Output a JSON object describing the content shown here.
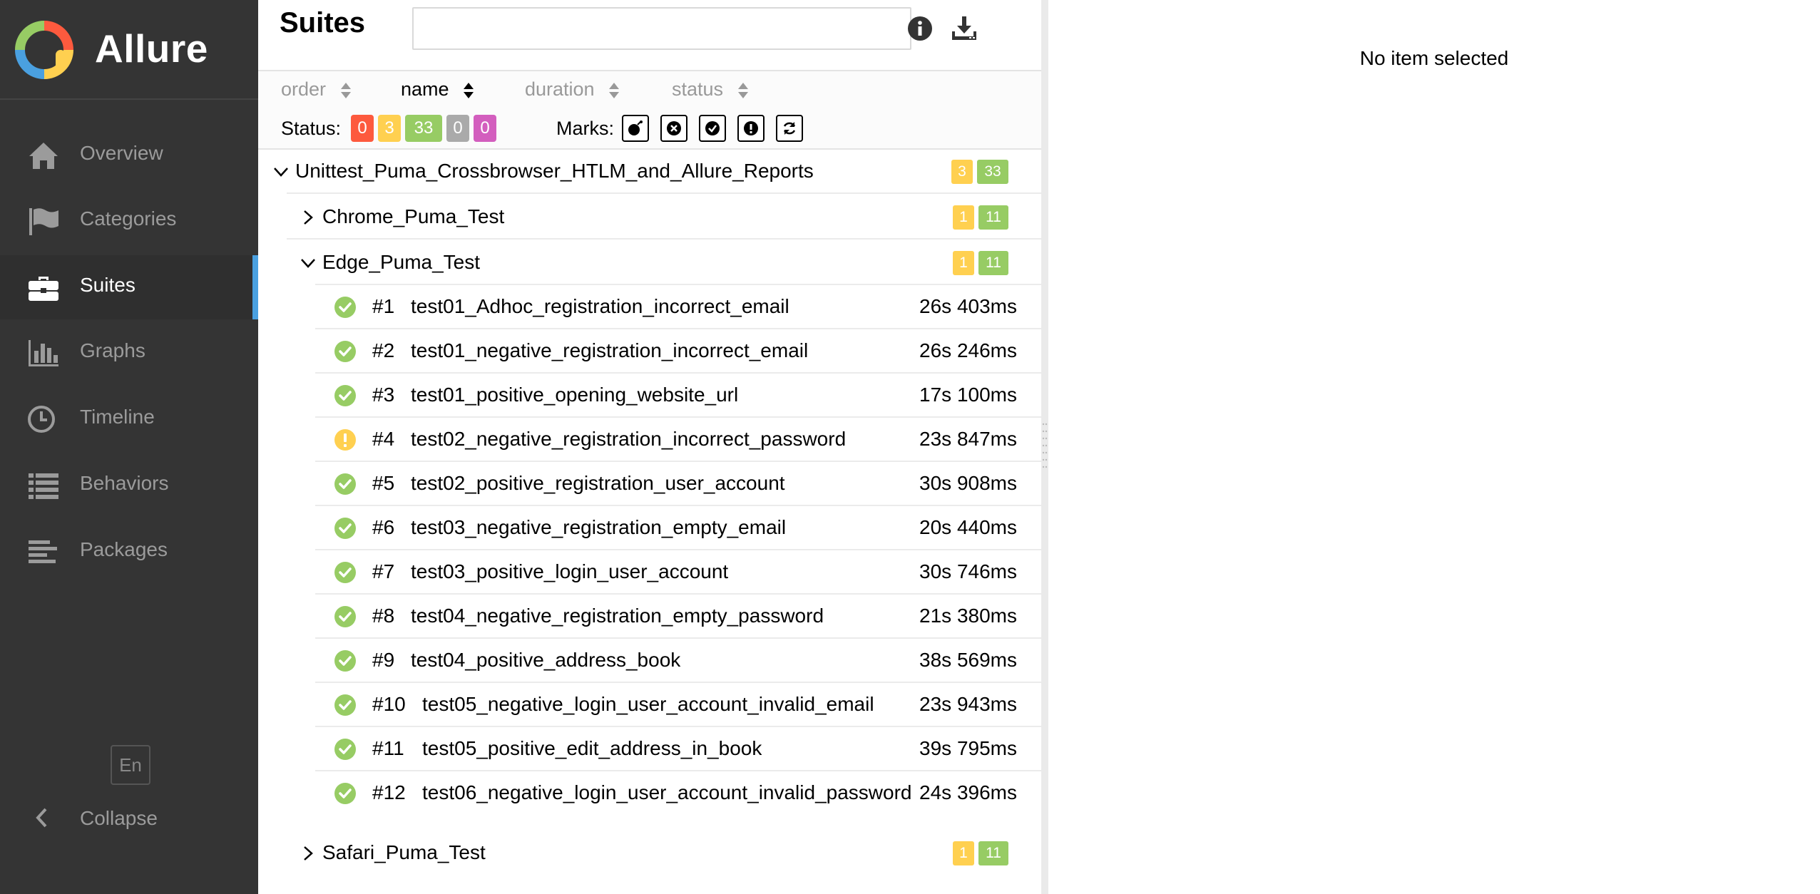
{
  "brand": {
    "name": "Allure"
  },
  "sidebar": {
    "items": [
      {
        "label": "Overview",
        "icon": "home-icon"
      },
      {
        "label": "Categories",
        "icon": "flag-icon"
      },
      {
        "label": "Suites",
        "icon": "briefcase-icon",
        "active": true
      },
      {
        "label": "Graphs",
        "icon": "bar-chart-icon"
      },
      {
        "label": "Timeline",
        "icon": "clock-icon"
      },
      {
        "label": "Behaviors",
        "icon": "list-icon"
      },
      {
        "label": "Packages",
        "icon": "align-left-icon"
      }
    ],
    "language": "En",
    "collapse_label": "Collapse"
  },
  "pane": {
    "title": "Suites",
    "search": {
      "value": "",
      "placeholder": ""
    },
    "sorters": [
      {
        "label": "order",
        "active": false
      },
      {
        "label": "name",
        "active": true
      },
      {
        "label": "duration",
        "active": false
      },
      {
        "label": "status",
        "active": false
      }
    ],
    "status_label": "Status:",
    "status_counts": [
      {
        "value": "0",
        "status": "failed",
        "color": "#fd5a3e"
      },
      {
        "value": "3",
        "status": "broken",
        "color": "#ffd050"
      },
      {
        "value": "33",
        "status": "passed",
        "color": "#97cc64"
      },
      {
        "value": "0",
        "status": "skipped",
        "color": "#aaaaaa"
      },
      {
        "value": "0",
        "status": "unknown",
        "color": "#d35ebe"
      }
    ],
    "marks_label": "Marks:",
    "marks": [
      "flaky-bomb-icon",
      "new-failed-icon",
      "new-passed-icon",
      "new-broken-icon",
      "retries-icon"
    ]
  },
  "tree": {
    "root": {
      "name": "Unittest_Puma_Crossbrowser_HTLM_and_Allure_Reports",
      "broken": "3",
      "passed": "33",
      "expanded": true
    },
    "groups": [
      {
        "name": "Chrome_Puma_Test",
        "broken": "1",
        "passed": "11",
        "expanded": false
      },
      {
        "name": "Edge_Puma_Test",
        "broken": "1",
        "passed": "11",
        "expanded": true
      },
      {
        "name": "Safari_Puma_Test",
        "broken": "1",
        "passed": "11",
        "expanded": false
      }
    ],
    "tests": [
      {
        "order": "#1",
        "name": "test01_Adhoc_registration_incorrect_email",
        "duration": "26s 403ms",
        "status": "passed"
      },
      {
        "order": "#2",
        "name": "test01_negative_registration_incorrect_email",
        "duration": "26s 246ms",
        "status": "passed"
      },
      {
        "order": "#3",
        "name": "test01_positive_opening_website_url",
        "duration": "17s 100ms",
        "status": "passed"
      },
      {
        "order": "#4",
        "name": "test02_negative_registration_incorrect_password",
        "duration": "23s 847ms",
        "status": "broken"
      },
      {
        "order": "#5",
        "name": "test02_positive_registration_user_account",
        "duration": "30s 908ms",
        "status": "passed"
      },
      {
        "order": "#6",
        "name": "test03_negative_registration_empty_email",
        "duration": "20s 440ms",
        "status": "passed"
      },
      {
        "order": "#7",
        "name": "test03_positive_login_user_account",
        "duration": "30s 746ms",
        "status": "passed"
      },
      {
        "order": "#8",
        "name": "test04_negative_registration_empty_password",
        "duration": "21s 380ms",
        "status": "passed"
      },
      {
        "order": "#9",
        "name": "test04_positive_address_book",
        "duration": "38s 569ms",
        "status": "passed"
      },
      {
        "order": "#10",
        "name": "test05_negative_login_user_account_invalid_email",
        "duration": "23s 943ms",
        "status": "passed"
      },
      {
        "order": "#11",
        "name": "test05_positive_edit_address_in_book",
        "duration": "39s 795ms",
        "status": "passed"
      },
      {
        "order": "#12",
        "name": "test06_negative_login_user_account_invalid_password",
        "duration": "24s 396ms",
        "status": "passed"
      }
    ]
  },
  "detail": {
    "empty_text": "No item selected"
  },
  "colors": {
    "sidebar_bg": "#343434",
    "active_accent": "#4aa0e0",
    "passed": "#97cc64",
    "broken": "#ffd050",
    "failed": "#fd5a3e"
  }
}
